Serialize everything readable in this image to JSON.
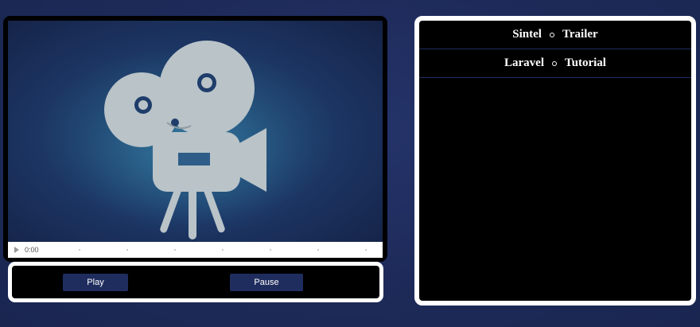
{
  "video": {
    "current_time": "0:00",
    "poster_icon": "movie-camera-icon"
  },
  "controls": {
    "play_label": "Play",
    "pause_label": "Pause"
  },
  "playlist": {
    "items": [
      {
        "first": "Sintel",
        "second": "Trailer"
      },
      {
        "first": "Laravel",
        "second": "Tutorial"
      }
    ]
  },
  "colors": {
    "background": "#1f2d5e",
    "panel": "#000000",
    "border": "#ffffff",
    "button": "#1f2d5e",
    "camera_icon": "#b9c3c8"
  }
}
